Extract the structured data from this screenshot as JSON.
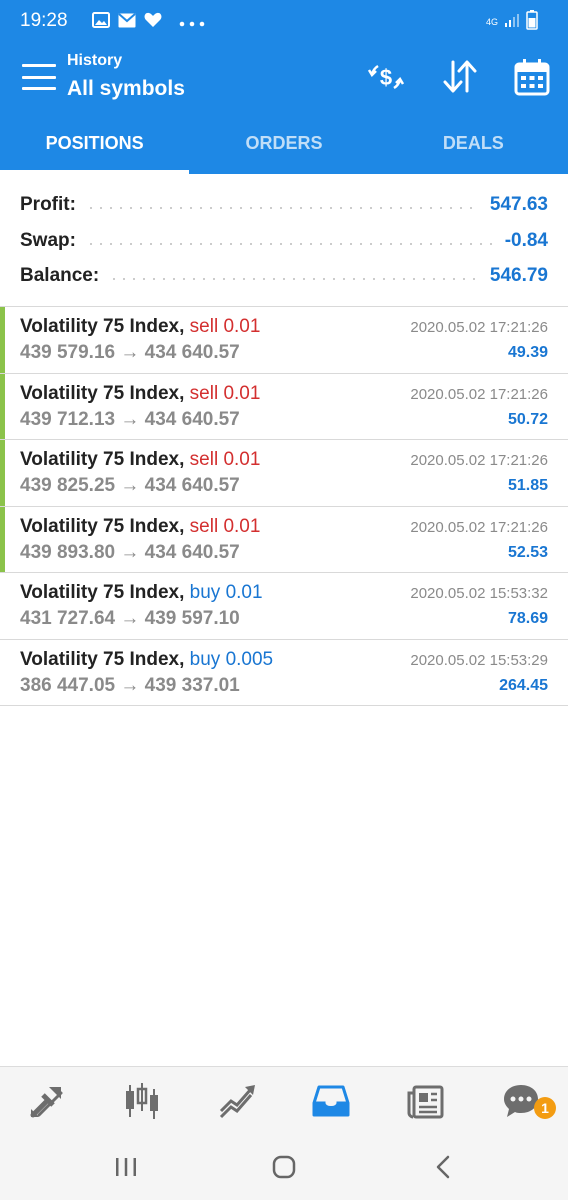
{
  "status_bar": {
    "time": "19:28",
    "network": "4G",
    "icons": [
      "image-icon",
      "mail-icon",
      "heart-icon",
      "more-dots-icon",
      "signal-icon",
      "battery-icon"
    ]
  },
  "header": {
    "subtitle": "History",
    "title": "All symbols",
    "background_color": "#1e88e5",
    "actions": [
      "currency-exchange-icon",
      "sort-icon",
      "calendar-icon"
    ]
  },
  "tabs": [
    {
      "label": "POSITIONS",
      "active": true
    },
    {
      "label": "ORDERS",
      "active": false
    },
    {
      "label": "DEALS",
      "active": false
    }
  ],
  "summary": {
    "profit_label": "Profit:",
    "profit_value": "547.63",
    "swap_label": "Swap:",
    "swap_value": "-0.84",
    "balance_label": "Balance:",
    "balance_value": "546.79"
  },
  "positions": [
    {
      "symbol": "Volatility 75 Index,",
      "side": "sell 0.01",
      "prices": "439 579.16 → 434 640.57",
      "time": "2020.05.02 17:21:26",
      "profit": "49.39"
    },
    {
      "symbol": "Volatility 75 Index,",
      "side": "sell 0.01",
      "prices": "439 712.13 → 434 640.57",
      "time": "2020.05.02 17:21:26",
      "profit": "50.72"
    },
    {
      "symbol": "Volatility 75 Index,",
      "side": "sell 0.01",
      "prices": "439 825.25 → 434 640.57",
      "time": "2020.05.02 17:21:26",
      "profit": "51.85"
    },
    {
      "symbol": "Volatility 75 Index,",
      "side": "sell 0.01",
      "prices": "439 893.80 → 434 640.57",
      "time": "2020.05.02 17:21:26",
      "profit": "52.53"
    },
    {
      "symbol": "Volatility 75 Index,",
      "side": "buy 0.01",
      "prices": "431 727.64 → 439 597.10",
      "time": "2020.05.02 15:53:32",
      "profit": "78.69"
    },
    {
      "symbol": "Volatility 75 Index,",
      "side": "buy 0.005",
      "prices": "386 447.05 → 439 337.01",
      "time": "2020.05.02 15:53:29",
      "profit": "264.45"
    }
  ],
  "colors": {
    "accent": "#1e88e5",
    "value_blue": "#1976d2",
    "sell_red": "#d32f2f",
    "profit_bar_green": "#8bc34a",
    "badge_orange": "#f39c12"
  },
  "bottom_nav": {
    "items": [
      "quotes-icon",
      "chart-icon",
      "trade-icon",
      "history-icon",
      "news-icon",
      "chat-icon"
    ],
    "active": "history-icon",
    "chat_badge": "1"
  },
  "system_nav": [
    "recent-apps-icon",
    "home-icon",
    "back-icon"
  ]
}
